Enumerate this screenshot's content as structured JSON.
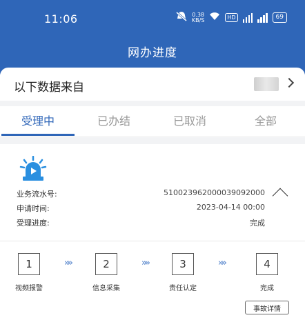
{
  "status_bar": {
    "time": "11:06",
    "speed_value": "0.38",
    "speed_unit": "KB/S",
    "hd_badge": "HD",
    "battery": "69"
  },
  "header": {
    "title": "网办进度"
  },
  "source": {
    "label": "以下数据来自"
  },
  "tabs": [
    {
      "label": "受理中",
      "active": true
    },
    {
      "label": "已办结",
      "active": false
    },
    {
      "label": "已取消",
      "active": false
    },
    {
      "label": "全部",
      "active": false
    }
  ],
  "record": {
    "serial_label": "业务流水号:",
    "serial_value": "510023962000039092000",
    "apply_time_label": "申请时间:",
    "apply_time_value": "2023-04-14 00:00",
    "progress_label": "受理进度:",
    "progress_value": "完成"
  },
  "steps": [
    {
      "number": "1",
      "label": "视频报警"
    },
    {
      "number": "2",
      "label": "信息采集"
    },
    {
      "number": "3",
      "label": "责任认定"
    },
    {
      "number": "4",
      "label": "完成"
    }
  ],
  "arrow_glyph": "»»",
  "detail_button": {
    "label": "事故详情"
  },
  "colors": {
    "primary": "#2f66b8",
    "alarm": "#2a8fe0"
  }
}
